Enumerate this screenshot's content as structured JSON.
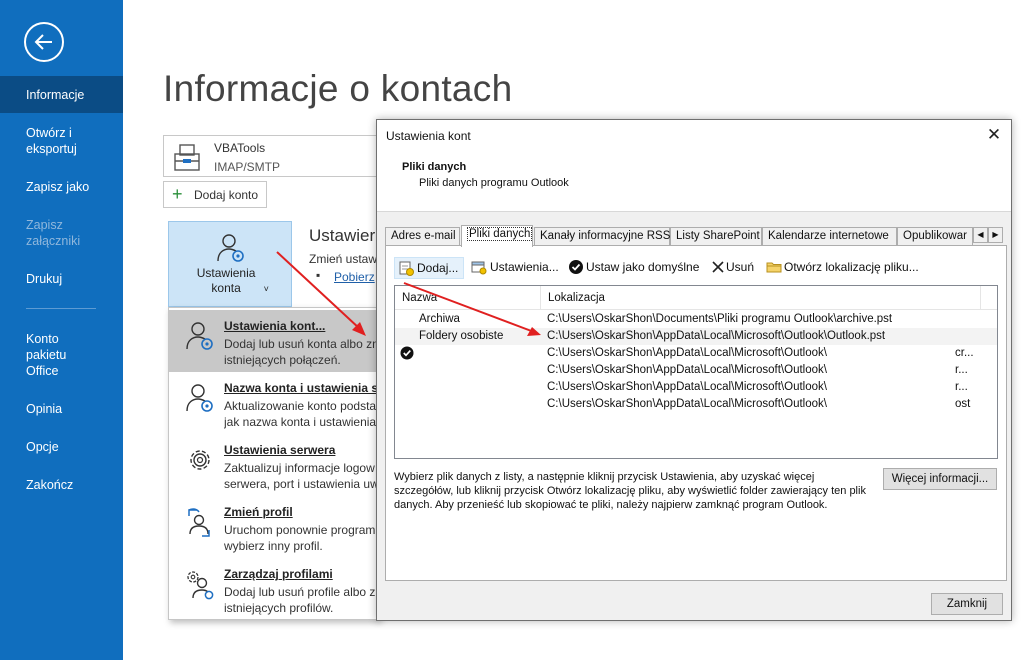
{
  "sidebar": {
    "items": [
      {
        "label": "Informacje",
        "state": "active"
      },
      {
        "label": "Otwórz i eksportuj",
        "state": "normal"
      },
      {
        "label": "Zapisz jako",
        "state": "normal"
      },
      {
        "label": "Zapisz załączniki",
        "state": "disabled"
      },
      {
        "label": "Drukuj",
        "state": "normal"
      },
      {
        "label": "Konto pakietu Office",
        "state": "normal"
      },
      {
        "label": "Opinia",
        "state": "normal"
      },
      {
        "label": "Opcje",
        "state": "normal"
      },
      {
        "label": "Zakończ",
        "state": "normal"
      }
    ],
    "accent_color": "#106ebe"
  },
  "main": {
    "title": "Informacje o kontach",
    "account": {
      "name": "VBATools",
      "type": "IMAP/SMTP"
    },
    "add_account_label": "Dodaj konto",
    "settings_tile_label": "Ustawienia konta",
    "section_title": "Ustawier",
    "section_desc": "Zmień ustaw",
    "section_link": "Pobierz"
  },
  "dropdown": {
    "items": [
      {
        "title": "Ustawienia kont...",
        "desc_line1": "Dodaj lub usuń konta albo zn",
        "desc_line2": "istniejących połączeń.",
        "icon": "account-settings-icon"
      },
      {
        "title": "Nazwa konta i ustawienia sy",
        "desc_line1": "Aktualizowanie konto podsta",
        "desc_line2": "jak nazwa konta i ustawienia",
        "icon": "account-name-icon"
      },
      {
        "title": "Ustawienia serwera",
        "desc_line1": "Zaktualizuj informacje logow",
        "desc_line2": "serwera, port i ustawienia uw",
        "icon": "server-gear-icon"
      },
      {
        "title": "Zmień profil",
        "desc_line1": "Uruchom ponownie program",
        "desc_line2": "wybierz inny profil.",
        "icon": "change-profile-icon"
      },
      {
        "title": "Zarządzaj profilami",
        "desc_line1": "Dodaj lub usuń profile albo z",
        "desc_line2": "istniejących profilów.",
        "icon": "manage-profiles-icon"
      }
    ]
  },
  "dialog": {
    "title": "Ustawienia kont",
    "close_glyph": "✕",
    "header_title": "Pliki danych",
    "header_subtitle": "Pliki danych programu Outlook",
    "tabs": [
      "Adres e-mail",
      "Pliki danych",
      "Kanały informacyjne RSS",
      "Listy SharePoint",
      "Kalendarze internetowe",
      "Opublikowar"
    ],
    "active_tab": "Pliki danych",
    "tab_scroll": {
      "left": "◀",
      "right": "▶"
    },
    "toolbar": {
      "add": "Dodaj...",
      "settings": "Ustawienia...",
      "set_default": "Ustaw jako domyślne",
      "remove": "Usuń",
      "open_location": "Otwórz lokalizację pliku..."
    },
    "columns": {
      "name": "Nazwa",
      "location": "Lokalizacja"
    },
    "rows": [
      {
        "name": "Archiwa",
        "location": "C:\\Users\\OskarShon\\Documents\\Pliki programu Outlook\\archive.pst",
        "extra": "",
        "default": false,
        "selected": false
      },
      {
        "name": "Foldery osobiste",
        "location": "C:\\Users\\OskarShon\\AppData\\Local\\Microsoft\\Outlook\\Outlook.pst",
        "extra": "",
        "default": false,
        "selected": true
      },
      {
        "name": "",
        "location": "C:\\Users\\OskarShon\\AppData\\Local\\Microsoft\\Outlook\\",
        "extra": "cr...",
        "default": true,
        "selected": false
      },
      {
        "name": "",
        "location": "C:\\Users\\OskarShon\\AppData\\Local\\Microsoft\\Outlook\\",
        "extra": "r...",
        "default": false,
        "selected": false
      },
      {
        "name": "",
        "location": "C:\\Users\\OskarShon\\AppData\\Local\\Microsoft\\Outlook\\",
        "extra": "r...",
        "default": false,
        "selected": false
      },
      {
        "name": "",
        "location": "C:\\Users\\OskarShon\\AppData\\Local\\Microsoft\\Outlook\\",
        "extra": "ost",
        "default": false,
        "selected": false
      }
    ],
    "info_text": "Wybierz plik danych z listy, a następnie kliknij przycisk Ustawienia, aby uzyskać więcej szczegółów, lub kliknij przycisk Otwórz lokalizację pliku, aby wyświetlić folder zawierający ten plik danych. Aby przenieść lub skopiować te pliki, należy najpierw zamknąć program Outlook.",
    "more_info_button": "Więcej informacji...",
    "close_button": "Zamknij"
  },
  "annotation_color": "#e02020"
}
